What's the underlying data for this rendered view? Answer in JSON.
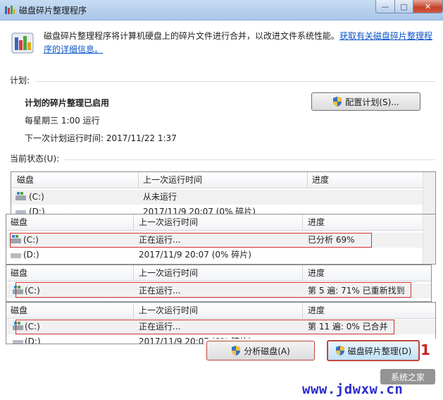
{
  "window": {
    "title": "磁盘碎片整理程序",
    "min_glyph": "—",
    "max_glyph": "□",
    "close_glyph": "✕"
  },
  "intro": {
    "text": "磁盘碎片整理程序将计算机硬盘上的碎片文件进行合并，以改进文件系统性能。",
    "link": "获取有关磁盘碎片整理程序的详细信息。"
  },
  "schedule": {
    "label": "计划:",
    "title": "计划的碎片整理已启用",
    "line1": "每星期三  1:00 运行",
    "line2": "下一次计划运行时间: 2017/11/22 1:37",
    "configure_button": "配置计划(S)..."
  },
  "status": {
    "label": "当前状态(U):"
  },
  "columns": {
    "disk": "磁盘",
    "last_run": "上一次运行时间",
    "progress": "进度"
  },
  "grids": [
    {
      "rows": [
        {
          "disk": "(C:)",
          "last_run": "从未运行",
          "progress": ""
        },
        {
          "disk": "(D:)",
          "last_run": "2017/11/9 20:07 (0% 碎片)",
          "progress": ""
        }
      ]
    },
    {
      "rows": [
        {
          "disk": "(C:)",
          "last_run": "正在运行...",
          "progress": "已分析 69%"
        },
        {
          "disk": "(D:)",
          "last_run": "2017/11/9 20:07 (0% 碎片)",
          "progress": ""
        }
      ]
    },
    {
      "rows": [
        {
          "disk": "(C:)",
          "last_run": "正在运行...",
          "progress": "第 5 遍: 71% 已重新找到"
        }
      ]
    },
    {
      "rows": [
        {
          "disk": "(C:)",
          "last_run": "正在运行...",
          "progress": "第 11 遍: 0% 已合并"
        },
        {
          "disk": "(D:)",
          "last_run": "2017/11/9 20:07 (0% 碎片)",
          "progress": ""
        }
      ]
    }
  ],
  "buttons": {
    "analyze": "分析磁盘(A)",
    "defrag": "磁盘碎片整理(D)"
  },
  "annotation": {
    "step_number": "1"
  },
  "watermark": {
    "badge": "系统之家",
    "url": "www.jdwxw.cn"
  }
}
